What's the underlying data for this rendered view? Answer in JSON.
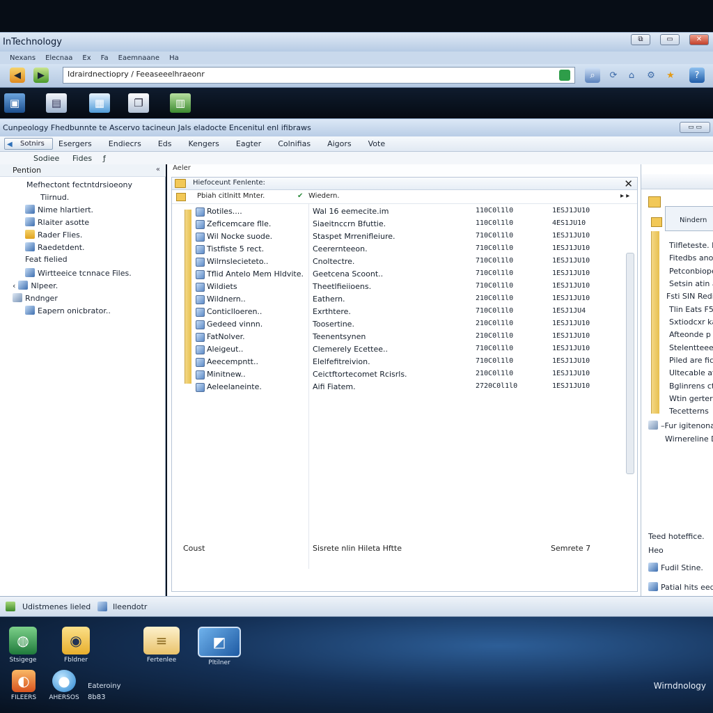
{
  "outer_window": {
    "title": "InTechnology",
    "menu": [
      "Nexans",
      "Elecnaa",
      "Ex",
      "Fa",
      "Eaemnaane",
      "Ha"
    ],
    "address": "Idrairdnectiopry / Feeaseeelhraeonr",
    "caption_buttons": [
      "⧉",
      "▭",
      "✕"
    ]
  },
  "mid_apps": [
    "app1",
    "app2",
    "app3",
    "app4",
    "app5"
  ],
  "inner_window": {
    "title": "Cunpeology Fhedbunnte te Ascervo tacineun Jals eladocte Encenitul enl ifibraws",
    "restore_label": "▭ ▭",
    "back_label": "Sotnirs",
    "menu": [
      "Esergers",
      "Endiecrs",
      "Eds",
      "Kengers",
      "Eagter",
      "Colnifias",
      "Aigors",
      "Vote"
    ],
    "subbar": [
      "Sodiee",
      "Fides",
      "ƒ"
    ]
  },
  "left_pane": {
    "header": "Pention",
    "items": [
      "Mefhectont fectntdrsioeony",
      "Tiirnud.",
      "Nime hlartiert.",
      "Rlaiter asotte",
      "Rader Flies.",
      "Raedetdent.",
      "Feat fielied",
      "Wirtteeice tcnnace Files.",
      "Nlpeer.",
      "Rndnger",
      "Eapern onicbrator.."
    ]
  },
  "center_pane": {
    "label": "Aeler",
    "list_title": "Hiefoceunt Fenlente:",
    "col1_header": "Pbiah citlnitt Mnter.",
    "col2_header": "Wiedern.",
    "rows": [
      {
        "name": "Rotiles....",
        "desc": "Wal 16 eemecite.im",
        "c3": "110C0l1l0",
        "c4": "1ESJ1JU10"
      },
      {
        "name": "Zeficemcare flle.",
        "desc": "Siaeitnccrn Bfuttie.",
        "c3": "110C0l1l0",
        "c4": "4ES1JU10"
      },
      {
        "name": "Wil Nocke suode.",
        "desc": "Staspet Mrrenifleiure.",
        "c3": "710C0l1l0",
        "c4": "1ESJ1JU10"
      },
      {
        "name": "Tistfiste 5 rect.",
        "desc": "Ceerernteeon.",
        "c3": "710C0l1l0",
        "c4": "1ESJ1JU10"
      },
      {
        "name": "Wilrnslecieteto..",
        "desc": "Cnoltectre.",
        "c3": "710C0l1l0",
        "c4": "1ESJ1JU10"
      },
      {
        "name": "Tflid Antelo Mem Hldvite.",
        "desc": "Geetcena Scoont..",
        "c3": "710C0l1l0",
        "c4": "1ESJ1JU10"
      },
      {
        "name": "Wildiets",
        "desc": "Theetlfieiioens.",
        "c3": "710C0l1l0",
        "c4": "1ESJ1JU10"
      },
      {
        "name": "Wildnern..",
        "desc": "Eathern.",
        "c3": "210C0l1l0",
        "c4": "1ESJ1JU10"
      },
      {
        "name": "Conticlloeren..",
        "desc": "Exrthtere.",
        "c3": "710C0l1l0",
        "c4": "1ESJ1JU4"
      },
      {
        "name": "Gedeed vinnn.",
        "desc": "Toosertine.",
        "c3": "210C0l1l0",
        "c4": "1ESJ1JU10"
      },
      {
        "name": "FatNolver.",
        "desc": "Teenentsynen",
        "c3": "210C0l1l0",
        "c4": "1ESJ1JU10"
      },
      {
        "name": "Aleigeut..",
        "desc": "Clemerely Ecettee..",
        "c3": "710C0l1l0",
        "c4": "1ESJ1JU10"
      },
      {
        "name": "Aeecempntt..",
        "desc": "Elelfefitreivion.",
        "c3": "710C0l1l0",
        "c4": "1ESJ1JU10"
      },
      {
        "name": "Minitnew..",
        "desc": "Ceictftortecomet Rcisrls.",
        "c3": "210C0l1l0",
        "c4": "1ESJ1JU10"
      },
      {
        "name": "Aeleelaneinte.",
        "desc": "Aifi Fiatem.",
        "c3": "2720C0l1l0",
        "c4": "1ESJ1JU10"
      }
    ],
    "footer_left": "Coust",
    "footer_mid": "Sisrete nlin Hileta Hftte",
    "footer_right": "Semrete 7"
  },
  "right_pane": {
    "card_label": "Nindern",
    "items": [
      "Tilfleteste. Neret",
      "Fitedbs anoatr",
      "Petconbioper",
      "Setsin atin ac",
      "Fsti SIN Redi",
      "Tlin Eats F5",
      "Sxtiodcxr kan",
      "Afteonde p rec",
      "Stelentteee to",
      "Piled are fice",
      "Ultecable aflr",
      "Bglinrens ctu",
      "Wtin gerter",
      "Tecetterns"
    ],
    "bottom_items": [
      "–Fur igitenonal",
      "Wirnereline D"
    ],
    "footer_items": [
      "Teed hoteffice.",
      "Heo",
      "Fudil Stine.",
      "Patial hits eed"
    ]
  },
  "statusbar": {
    "left": "Udistmenes lieled",
    "right": "Ileendotr"
  },
  "taskbar": {
    "apps": [
      {
        "label": "Stsigege"
      },
      {
        "label": "Fbldner"
      },
      {
        "label": "Fertenlee"
      },
      {
        "label": "Pltilner"
      }
    ],
    "second_row": [
      {
        "label": "FILEERS"
      },
      {
        "label": "AHERSOS"
      }
    ],
    "clock_line1": "Eateroiny",
    "clock_line2": "8b83",
    "tray": "Wirndnology"
  }
}
